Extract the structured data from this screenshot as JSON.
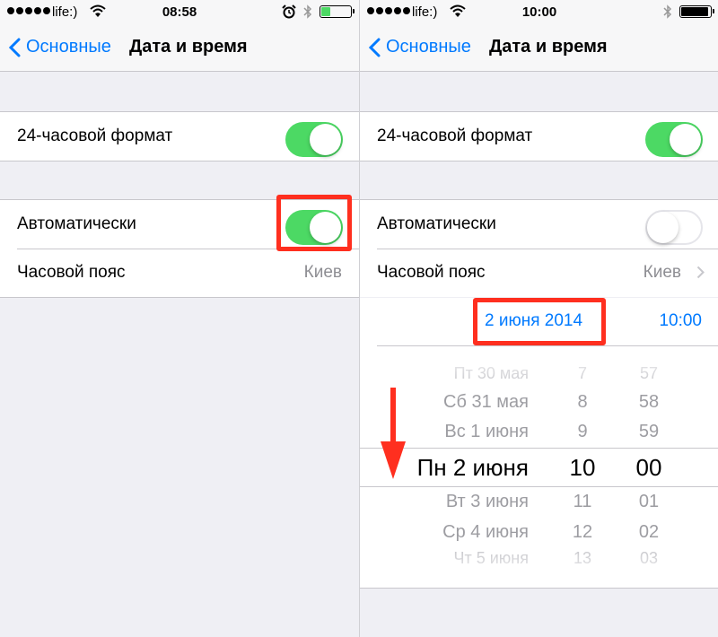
{
  "left_screen": {
    "status": {
      "carrier": "life:)",
      "time": "08:58"
    },
    "nav": {
      "back_label": "Основные",
      "title": "Дата и время"
    },
    "format_24h": {
      "label": "24-часовой формат",
      "enabled": true
    },
    "auto": {
      "label": "Автоматически",
      "enabled": true
    },
    "timezone": {
      "label": "Часовой пояс",
      "value": "Киев"
    }
  },
  "right_screen": {
    "status": {
      "carrier": "life:)",
      "time": "10:00"
    },
    "nav": {
      "back_label": "Основные",
      "title": "Дата и время"
    },
    "format_24h": {
      "label": "24-часовой формат",
      "enabled": true
    },
    "auto": {
      "label": "Автоматически",
      "enabled": false
    },
    "timezone": {
      "label": "Часовой пояс",
      "value": "Киев"
    },
    "selected": {
      "date": "2 июня 2014",
      "time": "10:00"
    },
    "picker": {
      "days": [
        "Пт 30 мая",
        "Сб 31 мая",
        "Вс 1 июня",
        "Пн 2 июня",
        "Вт 3 июня",
        "Ср 4 июня",
        "Чт 5 июня"
      ],
      "hours": [
        "7",
        "8",
        "9",
        "10",
        "11",
        "12",
        "13"
      ],
      "minutes": [
        "57",
        "58",
        "59",
        "00",
        "01",
        "02",
        "03"
      ]
    }
  },
  "colors": {
    "accent": "#007aff",
    "switch_on": "#4cd964",
    "highlight": "#ff2f1f"
  },
  "icons": [
    "wifi-icon",
    "alarm-icon",
    "bluetooth-icon",
    "battery-icon",
    "chevron-left-icon",
    "chevron-right-icon",
    "arrow-down-icon"
  ]
}
